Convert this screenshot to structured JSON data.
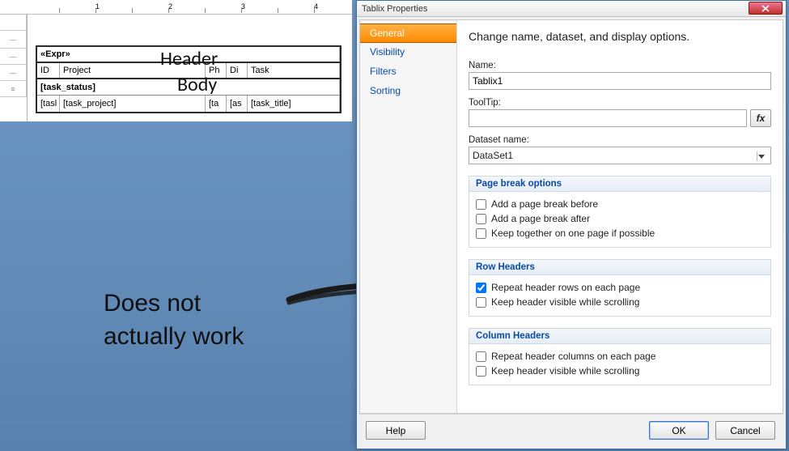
{
  "designer": {
    "ruler_marks": [
      "1",
      "2",
      "3",
      "4"
    ],
    "rows": {
      "expr": "«Expr»",
      "header_cells": [
        "ID",
        "Project",
        "Ph",
        "Di",
        "Task"
      ],
      "group_label": "[task_status]",
      "body_cells": [
        "[tasl",
        "[task_project]",
        "[ta",
        "[as",
        "[task_title]"
      ]
    },
    "annotations": {
      "header": "Header",
      "body": "Body",
      "big_line1": "Does not",
      "big_line2": "actually work"
    }
  },
  "dialog": {
    "title": "Tablix Properties",
    "sidebar": [
      "General",
      "Visibility",
      "Filters",
      "Sorting"
    ],
    "intro": "Change name, dataset, and display options.",
    "name_label": "Name:",
    "name_value": "Tablix1",
    "tooltip_label": "ToolTip:",
    "tooltip_value": "",
    "fx": "fx",
    "dataset_label": "Dataset name:",
    "dataset_value": "DataSet1",
    "groups": {
      "page_break": {
        "title": "Page break options",
        "items": [
          {
            "label": "Add a page break before",
            "checked": false
          },
          {
            "label": "Add a page break after",
            "checked": false
          },
          {
            "label": "Keep together on one page if possible",
            "checked": false
          }
        ]
      },
      "row_headers": {
        "title": "Row Headers",
        "items": [
          {
            "label": "Repeat header rows on each page",
            "checked": true
          },
          {
            "label": "Keep header visible while scrolling",
            "checked": false
          }
        ]
      },
      "column_headers": {
        "title": "Column Headers",
        "items": [
          {
            "label": "Repeat header columns on each page",
            "checked": false
          },
          {
            "label": "Keep header visible while scrolling",
            "checked": false
          }
        ]
      }
    },
    "buttons": {
      "help": "Help",
      "ok": "OK",
      "cancel": "Cancel"
    }
  }
}
